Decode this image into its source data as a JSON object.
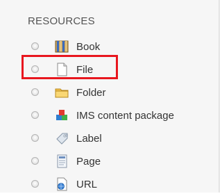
{
  "section": {
    "title": "RESOURCES"
  },
  "items": [
    {
      "label": "Book",
      "icon": "book-icon"
    },
    {
      "label": "File",
      "icon": "file-icon"
    },
    {
      "label": "Folder",
      "icon": "folder-icon"
    },
    {
      "label": "IMS content package",
      "icon": "ims-package-icon"
    },
    {
      "label": "Label",
      "icon": "label-icon"
    },
    {
      "label": "Page",
      "icon": "page-icon"
    },
    {
      "label": "URL",
      "icon": "url-icon"
    }
  ],
  "highlighted_item": "File",
  "colors": {
    "highlight": "#e8161e",
    "panel_background": "#f6f6f6",
    "text": "#333333"
  }
}
